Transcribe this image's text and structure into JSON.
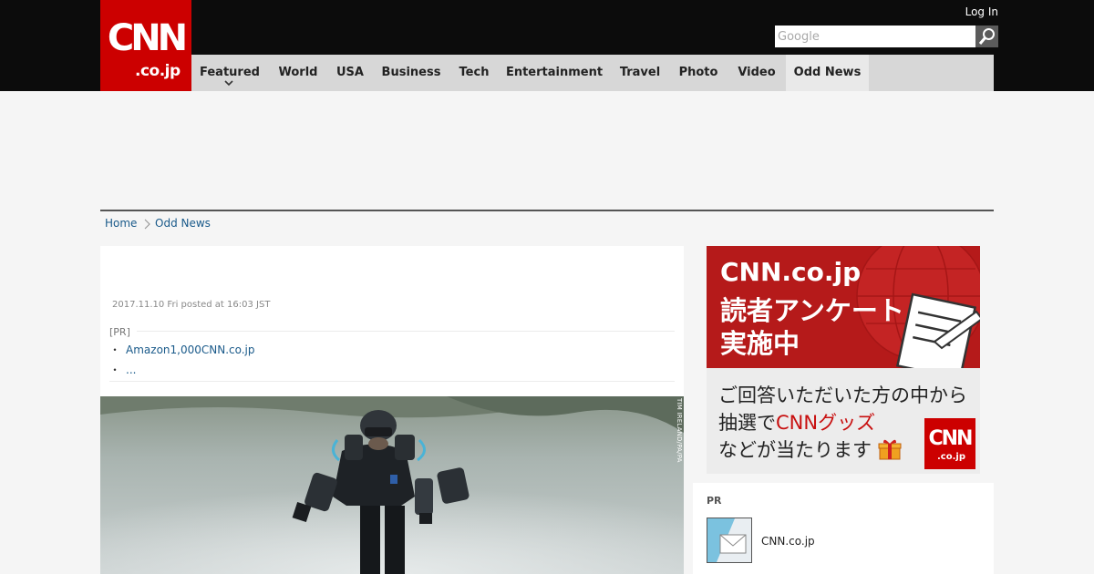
{
  "header": {
    "logo_main": "CNN",
    "logo_sub": ".co.jp",
    "login_label": "Log In",
    "search_placeholder": "Google",
    "search_icon": "magnifier-icon"
  },
  "nav": {
    "items": [
      {
        "label": "Featured"
      },
      {
        "label": "World"
      },
      {
        "label": "USA"
      },
      {
        "label": "Business"
      },
      {
        "label": "Tech"
      },
      {
        "label": "Entertainment"
      },
      {
        "label": "Travel"
      },
      {
        "label": "Photo"
      },
      {
        "label": "Video"
      },
      {
        "label": "Odd News"
      }
    ],
    "active": "Odd News"
  },
  "breadcrumb": {
    "home": "Home",
    "current": "Odd News"
  },
  "article": {
    "date": "2017.11.10 Fri posted at 16:03 JST",
    "pr_tag": "[PR]",
    "pr_links": [
      {
        "bullet": "・",
        "text": "Amazon1,000CNN.co.jp"
      },
      {
        "bullet": "・",
        "text": "..."
      }
    ],
    "photo_credit": "TIM IRELAND/PA/PA"
  },
  "banner": {
    "line1": "CNN.co.jp",
    "line2": "読者アンケート",
    "line3": "実施中",
    "line4": "ご回答いただいた方の中から",
    "line5_prefix": "抽選で",
    "line5_highlight": "CNNグッズ",
    "line6": "などが当たります",
    "logo_main": "CNN",
    "logo_sub": ".co.jp"
  },
  "sidebar_pr": {
    "label": "PR",
    "item_title": "CNN.co.jp"
  },
  "colors": {
    "brand_red": "#cc0000",
    "topbar": "#0c0c0c",
    "nav_bg": "#d7d7d7",
    "link": "#1a5a8a"
  }
}
